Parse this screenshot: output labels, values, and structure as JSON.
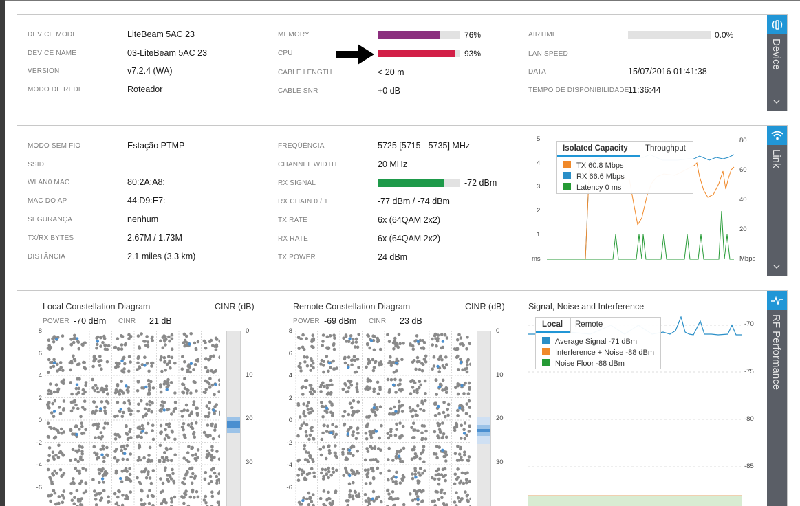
{
  "device": {
    "side_label": "Device",
    "icon": "antenna-icon",
    "col1": [
      {
        "label": "DEVICE MODEL",
        "value": "LiteBeam 5AC 23"
      },
      {
        "label": "DEVICE NAME",
        "value": "03-LiteBeam 5AC 23"
      },
      {
        "label": "VERSION",
        "value": "v7.2.4 (WA)"
      },
      {
        "label": "MODO DE REDE",
        "value": "Roteador"
      }
    ],
    "memory": {
      "label": "MEMORY",
      "value": "76%",
      "fraction": 0.76,
      "color": "#8b2f7e"
    },
    "cpu": {
      "label": "CPU",
      "value": "93%",
      "fraction": 0.93,
      "color": "#d21f47"
    },
    "cable_length": {
      "label": "CABLE LENGTH",
      "value": "< 20 m"
    },
    "cable_snr": {
      "label": "CABLE SNR",
      "value": "+0 dB"
    },
    "airtime": {
      "label": "AIRTIME",
      "value": "0.0%",
      "fraction": 0.0
    },
    "lan_speed": {
      "label": "LAN SPEED",
      "value": "-"
    },
    "data": {
      "label": "DATA",
      "value": "15/07/2016 01:41:38"
    },
    "uptime": {
      "label": "TEMPO DE DISPONIBILIDADE",
      "value": "11:36:44"
    }
  },
  "link": {
    "side_label": "Link",
    "icon": "wifi-icon",
    "col1": [
      {
        "label": "MODO SEM FIO",
        "value": "Estação PTMP"
      },
      {
        "label": "SSID",
        "value": ""
      },
      {
        "label": "WLAN0 MAC",
        "value": "80:2A:A8:"
      },
      {
        "label": "MAC DO AP",
        "value": "44:D9:E7:"
      },
      {
        "label": "SEGURANÇA",
        "value": "nenhum"
      },
      {
        "label": "TX/RX BYTES",
        "value": "2.67M / 1.73M"
      },
      {
        "label": "DISTÂNCIA",
        "value": "2.1 miles (3.3 km)"
      }
    ],
    "col2": [
      {
        "label": "FREQÜÊNCIA",
        "value": "5725 [5715 - 5735] MHz"
      },
      {
        "label": "CHANNEL WIDTH",
        "value": "20 MHz"
      },
      {
        "label": "RX SIGNAL",
        "value": "-72 dBm"
      },
      {
        "label": "RX CHAIN 0 / 1",
        "value": "-77 dBm / -74 dBm"
      },
      {
        "label": "TX RATE",
        "value": "6x (64QAM 2x2)"
      },
      {
        "label": "RX RATE",
        "value": "6x (64QAM 2x2)"
      },
      {
        "label": "TX POWER",
        "value": "24 dBm"
      }
    ],
    "rx_signal_fraction": 0.8,
    "rx_signal_color": "#1e9a4a",
    "capacity_chart": {
      "tabs": [
        "Isolated Capacity",
        "Throughput"
      ],
      "legend": [
        {
          "label": "TX 60.8 Mbps",
          "color": "#f0892a"
        },
        {
          "label": "RX 66.6 Mbps",
          "color": "#2a8fc8"
        },
        {
          "label": "Latency 0 ms",
          "color": "#259a35"
        }
      ],
      "left_ticks": [
        "5",
        "4",
        "3",
        "2",
        "1",
        "ms"
      ],
      "right_ticks": [
        "80",
        "60",
        "40",
        "20",
        "Mbps"
      ]
    }
  },
  "rf": {
    "side_label": "RF Performance",
    "icon": "pulse-icon",
    "local": {
      "title": "Local Constellation Diagram",
      "cinr_title": "CINR (dB)",
      "power_label": "POWER",
      "power_value": "-70 dBm",
      "cinr_label": "CINR",
      "cinr_value": "21 dB",
      "y_ticks": [
        "8",
        "6",
        "4",
        "2",
        "0",
        "-2",
        "-4",
        "-6"
      ],
      "cinr_ticks": [
        "0",
        "10",
        "20",
        "30"
      ]
    },
    "remote": {
      "title": "Remote Constellation Diagram",
      "cinr_title": "CINR (dB)",
      "power_label": "POWER",
      "power_value": "-69 dBm",
      "cinr_label": "CINR",
      "cinr_value": "23 dB",
      "y_ticks": [
        "8",
        "6",
        "4",
        "2",
        "0",
        "-2",
        "-4",
        "-6"
      ],
      "cinr_ticks": [
        "0",
        "10",
        "20",
        "30"
      ]
    },
    "sni": {
      "title": "Signal, Noise and Interference",
      "tabs": [
        "Local",
        "Remote"
      ],
      "legend": [
        {
          "label": "Average Signal -71 dBm",
          "color": "#2a8fc8"
        },
        {
          "label": "Interference + Noise -88 dBm",
          "color": "#f0892a"
        },
        {
          "label": "Noise Floor -88 dBm",
          "color": "#259a35"
        }
      ],
      "right_ticks": [
        "-70",
        "-75",
        "-80",
        "-85"
      ]
    }
  }
}
